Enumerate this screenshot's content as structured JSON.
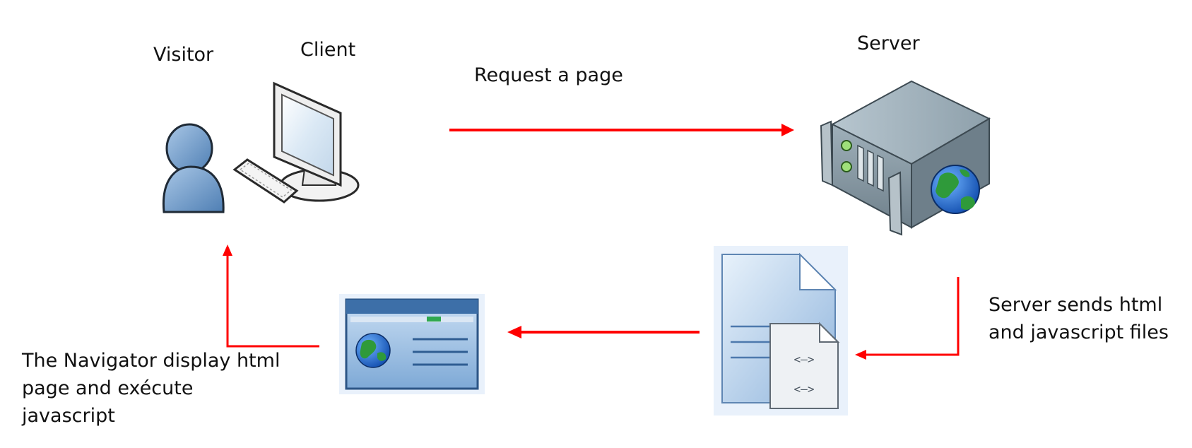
{
  "labels": {
    "visitor": "Visitor",
    "client": "Client",
    "server": "Server",
    "request": "Request a page",
    "server_sends": [
      "Server sends html",
      "and javascript files"
    ],
    "navigator": [
      "The Navigator display html",
      "page and exécute",
      "javascript"
    ]
  },
  "icons": {
    "visitor": "user-icon",
    "client": "desktop-computer-icon",
    "server": "web-server-icon",
    "files": "html-script-files-icon",
    "browser": "browser-window-icon"
  },
  "colors": {
    "arrow": "#ff0000",
    "server_body": "#8a9aa4",
    "globe_water": "#1f6fd6",
    "globe_land": "#2f9a3a",
    "user": "#6f9ac8",
    "document": "#bcd5ee"
  }
}
